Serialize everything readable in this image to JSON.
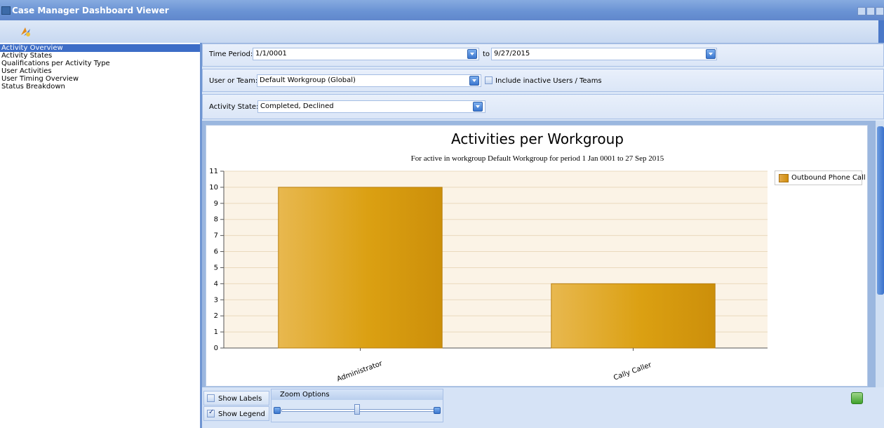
{
  "window": {
    "title": "Case Manager Dashboard Viewer"
  },
  "sidebar": {
    "items": [
      {
        "label": "Activity Overview",
        "selected": true
      },
      {
        "label": "Activity States"
      },
      {
        "label": "Qualifications per Activity Type"
      },
      {
        "label": "User Activities"
      },
      {
        "label": "User Timing Overview"
      },
      {
        "label": "Status Breakdown"
      }
    ]
  },
  "filters": {
    "time_period_label": "Time Period:",
    "time_from": "1/1/0001",
    "to_label": "to",
    "time_to": "9/27/2015",
    "user_team_label": "User or Team:",
    "user_team_value": "Default Workgroup (Global)",
    "include_inactive_label": "Include inactive Users / Teams",
    "activity_state_label": "Activity State:",
    "activity_state_value": "Completed, Declined"
  },
  "chart_data": {
    "type": "bar",
    "title": "Activities per Workgroup",
    "subtitle": "For active in workgroup Default Workgroup for period 1 Jan 0001 to 27 Sep 2015",
    "categories": [
      "Administrator",
      "Cally Caller"
    ],
    "series": [
      {
        "name": "Outbound Phone Call",
        "values": [
          10,
          4
        ],
        "color": "#dba12f"
      }
    ],
    "ylim": [
      0,
      11
    ],
    "yticks": [
      0,
      1,
      2,
      3,
      4,
      5,
      6,
      7,
      8,
      9,
      10,
      11
    ],
    "legend": "top-right",
    "grid": true,
    "plot_background": "#fbf3e6"
  },
  "options": {
    "show_labels": "Show Labels",
    "show_labels_checked": false,
    "show_legend": "Show Legend",
    "show_legend_checked": true,
    "zoom_title": "Zoom Options"
  }
}
